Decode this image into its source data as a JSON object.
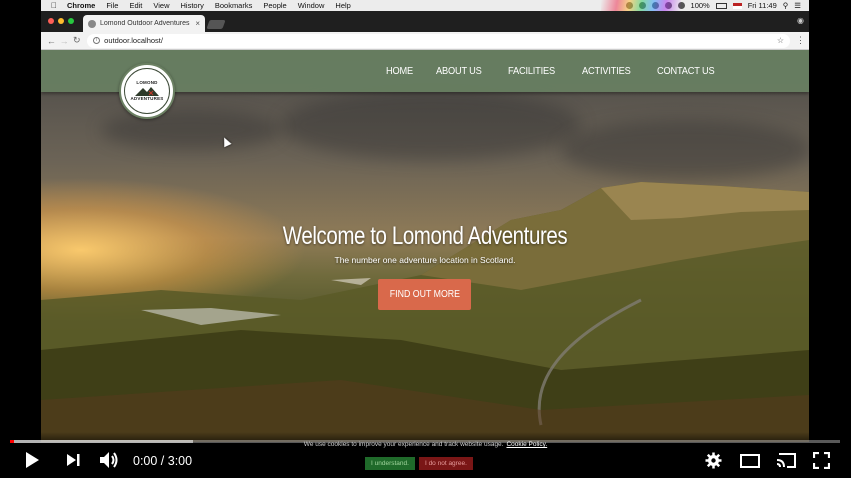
{
  "mac_menubar": {
    "app": "Chrome",
    "items": [
      "File",
      "Edit",
      "View",
      "History",
      "Bookmarks",
      "People",
      "Window",
      "Help"
    ],
    "battery": "100%",
    "clock": "Fri 11:49"
  },
  "browser": {
    "tab_title": "Lomond Outdoor Adventures",
    "url": "outdoor.localhost/"
  },
  "site": {
    "logo_top": "LOMOND",
    "logo_bottom": "ADVENTURES",
    "nav": [
      "HOME",
      "ABOUT US",
      "FACILITIES",
      "ACTIVITIES",
      "CONTACT US"
    ],
    "hero_title": "Welcome to Lomond Adventures",
    "hero_subtitle": "The number one adventure location in Scotland.",
    "cta": "FIND OUT MORE"
  },
  "player": {
    "time": "0:00 / 3:00",
    "loaded_fraction": 0.22,
    "cookie_text": "We use cookies to improve your experience and track website usage.",
    "cookie_link": "Cookie Policy.",
    "cookie_accept": "I understand.",
    "cookie_decline": "I do not agree.",
    "icons": [
      "play-icon",
      "next-icon",
      "volume-icon",
      "settings-icon",
      "miniplayer-icon",
      "cast-icon",
      "fullscreen-icon"
    ]
  },
  "colors": {
    "header_bg": "#688062",
    "cta_bg": "#d9694b",
    "progress_played": "#ff0000"
  }
}
